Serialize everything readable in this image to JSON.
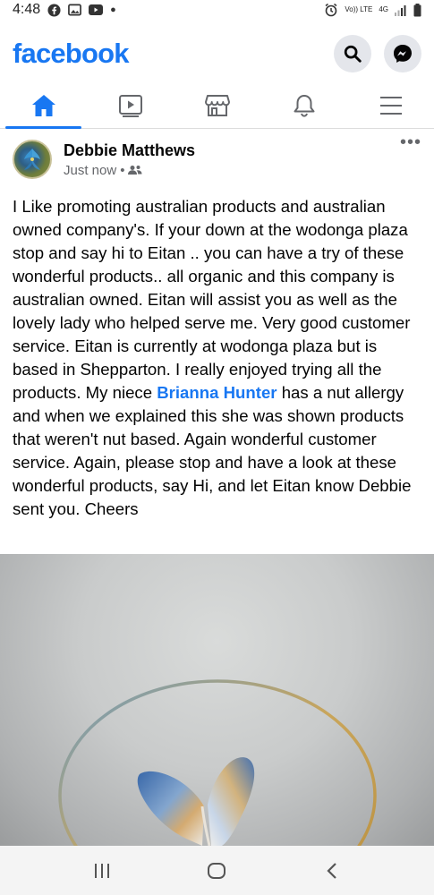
{
  "status_bar": {
    "time": "4:48",
    "network_label": "Vo)) LTE",
    "network_type": "4G",
    "icons": [
      "facebook-icon",
      "gallery-icon",
      "youtube-icon",
      "alarm-icon",
      "signal-icon",
      "battery-icon"
    ]
  },
  "header": {
    "logo": "facebook",
    "brand_color": "#1877f2",
    "buttons": [
      "search-icon",
      "messenger-icon"
    ]
  },
  "tabs": [
    {
      "icon": "home-icon",
      "active": true
    },
    {
      "icon": "watch-icon",
      "active": false
    },
    {
      "icon": "marketplace-icon",
      "active": false
    },
    {
      "icon": "notifications-icon",
      "active": false
    },
    {
      "icon": "menu-icon",
      "active": false
    }
  ],
  "post": {
    "author": "Debbie Matthews",
    "time": "Just now",
    "separator": "•",
    "audience_icon": "friends-icon",
    "more_label": "•••",
    "text_part1": "I Like promoting australian products and australian owned company's. If your down at the wodonga plaza stop and say hi to Eitan .. you can have a try of these wonderful products.. all organic and this company is australian owned. Eitan will assist you as well as the lovely lady who helped serve me. Very good customer service. Eitan is currently at wodonga plaza  but is based in Shepparton. I  really enjoyed trying all the products. My niece ",
    "mention": "Brianna Hunter",
    "text_part2": " has a nut allergy and when we explained this she was shown products that weren't nut based. Again wonderful customer service.  Again, please stop and have a look at these wonderful products, say Hi, and let Eitan know Debbie sent you. Cheers"
  },
  "nav_bar": {
    "buttons": [
      "recent-apps-icon",
      "home-circle-icon",
      "back-icon"
    ]
  }
}
